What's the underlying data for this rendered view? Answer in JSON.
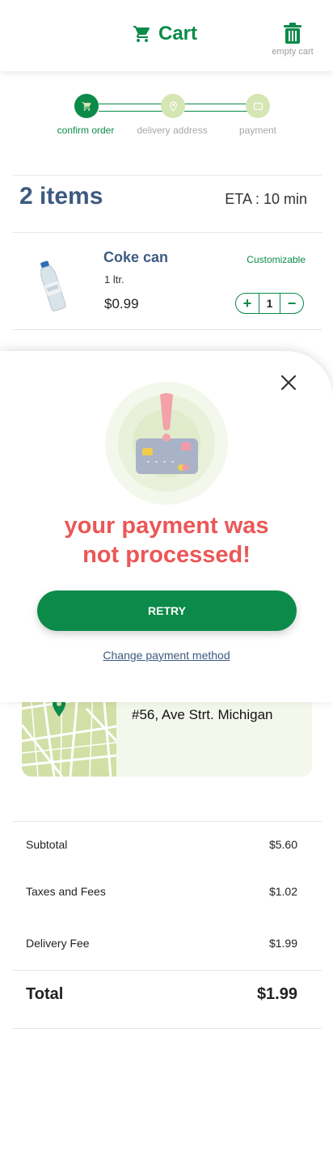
{
  "header": {
    "title": "Cart",
    "empty_cart_label": "empty cart",
    "cart_icon": "cart-icon",
    "trash_icon": "trash-icon"
  },
  "steps": [
    {
      "label": "confirm order",
      "state": "active"
    },
    {
      "label": "delivery address",
      "state": "inactive"
    },
    {
      "label": "payment",
      "state": "inactive"
    }
  ],
  "cart": {
    "items_count": "2 items",
    "eta": "ETA : 10 min"
  },
  "items": [
    {
      "name": "Coke can",
      "size": "1 ltr.",
      "price": "$0.99",
      "tag": "Customizable",
      "qty": "1",
      "plus": "+",
      "minus": "−"
    }
  ],
  "address": {
    "text": "#56, Ave Strt. Michigan"
  },
  "summary": {
    "subtotal_label": "Subtotal",
    "subtotal_value": "$5.60",
    "taxes_label": "Taxes and Fees",
    "taxes_value": "$1.02",
    "delivery_label": "Delivery Fee",
    "delivery_value": "$1.99",
    "total_label": "Total",
    "total_value": "$1.99"
  },
  "modal": {
    "title_line1": "your payment was",
    "title_line2": "not processed!",
    "retry_label": "RETRY",
    "change_label": "Change payment method"
  },
  "colors": {
    "brand": "#0b8a4a",
    "error": "#eb5757",
    "heading": "#3d5a80",
    "step_inactive": "#d5e6b4"
  }
}
